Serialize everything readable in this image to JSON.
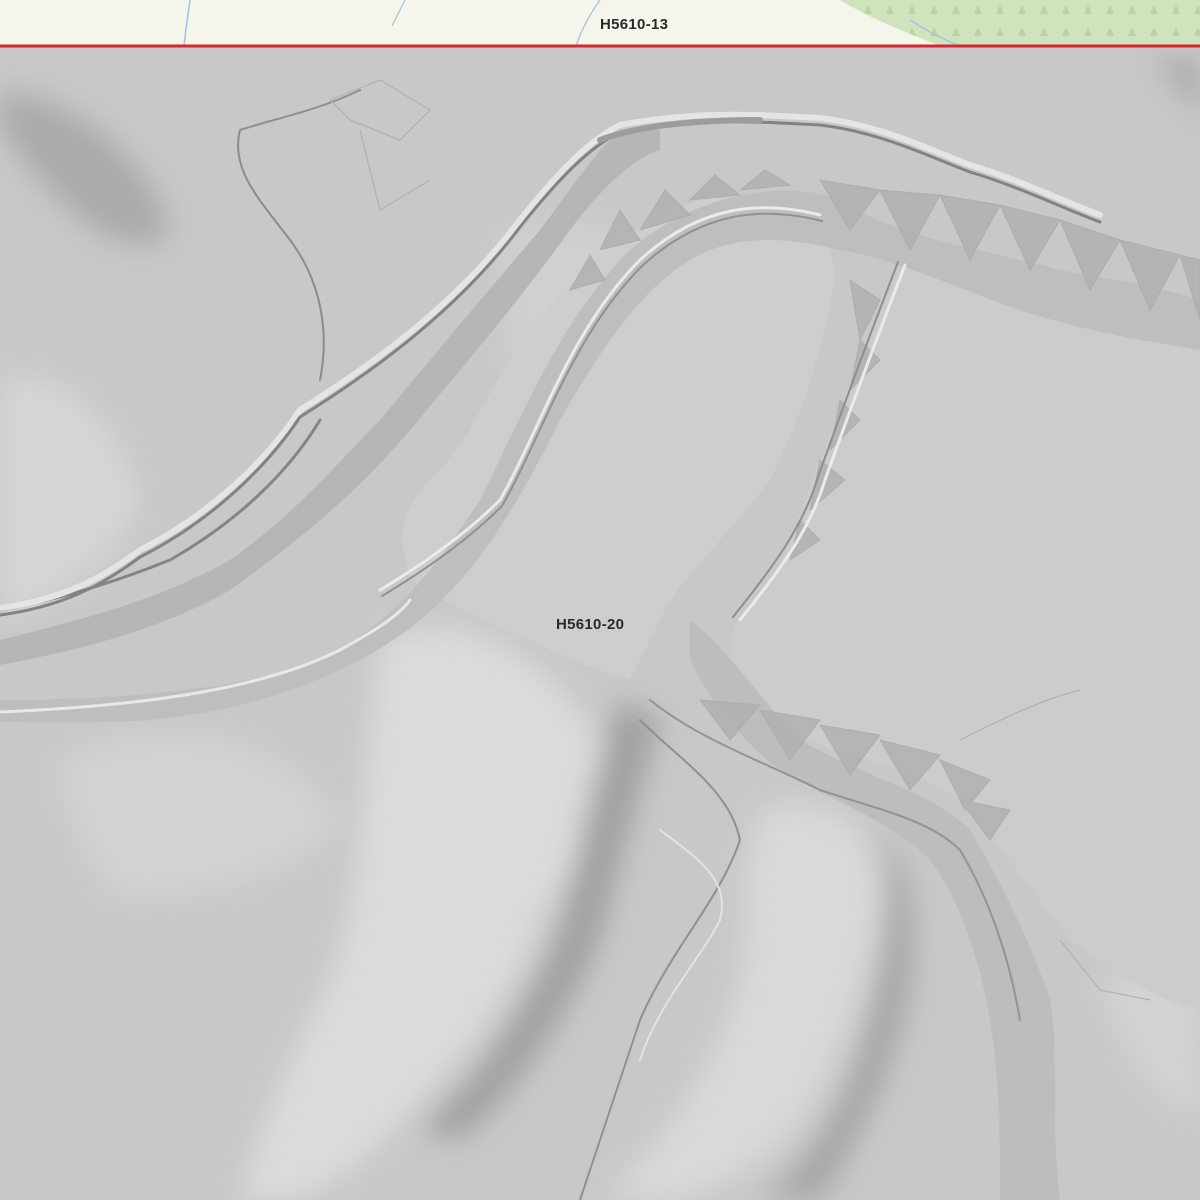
{
  "sheet_labels": {
    "adjacent_sheet": "H5610-13",
    "current_sheet": "H5610-20"
  },
  "colors": {
    "terrain_base": "#c9c9c9",
    "neighbor_map_background": "#f6f5ec",
    "sheet_boundary": "#d9262b",
    "forest_green": "#cfe3bd",
    "stream_blue": "#9cc3e0",
    "river_channel": "#bdbdbd",
    "highlight": "#e3e3e3",
    "shadow": "#8f8f8f"
  }
}
